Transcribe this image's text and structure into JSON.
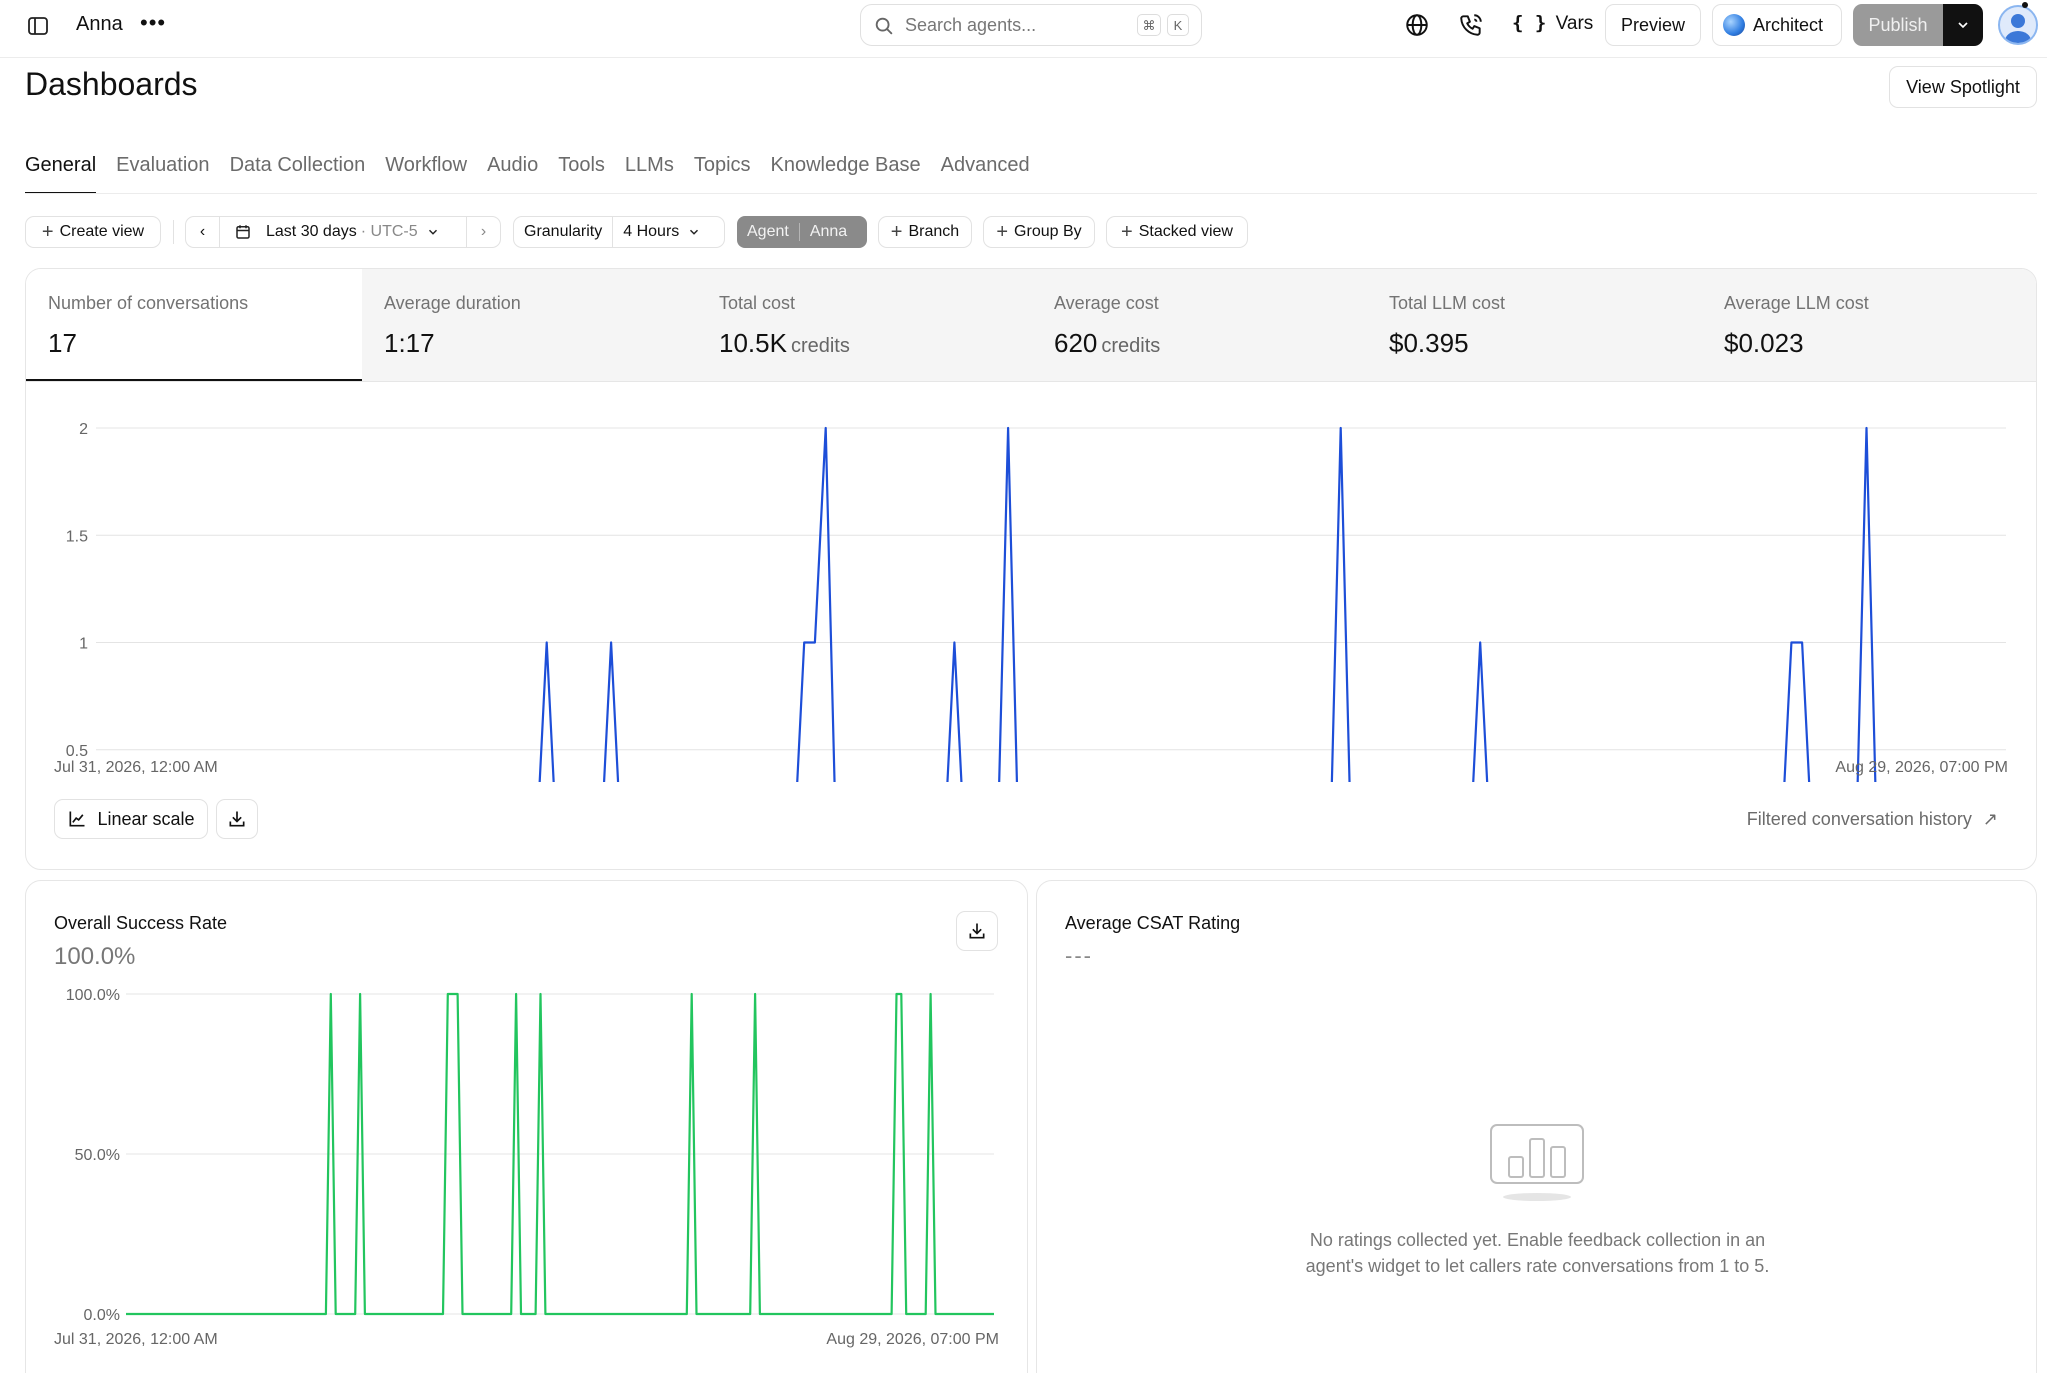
{
  "topbar": {
    "agent_name": "Anna",
    "search_placeholder": "Search agents...",
    "shortcut_mod": "⌘",
    "shortcut_key": "K",
    "vars_label": "Vars",
    "preview_label": "Preview",
    "architect_label": "Architect",
    "publish_label": "Publish"
  },
  "page": {
    "title": "Dashboards",
    "view_spotlight_label": "View Spotlight"
  },
  "tabs": [
    "General",
    "Evaluation",
    "Data Collection",
    "Workflow",
    "Audio",
    "Tools",
    "LLMs",
    "Topics",
    "Knowledge Base",
    "Advanced"
  ],
  "filters": {
    "create_view": "Create view",
    "date_range": "Last 30 days",
    "timezone": "· UTC-5",
    "granularity_label": "Granularity",
    "granularity_value": "4 Hours",
    "agent_label": "Agent",
    "agent_value": "Anna",
    "branch": "Branch",
    "group_by": "Group By",
    "stacked_view": "Stacked view"
  },
  "metrics": [
    {
      "label": "Number of conversations",
      "value": "17",
      "unit": ""
    },
    {
      "label": "Average duration",
      "value": "1:17",
      "unit": ""
    },
    {
      "label": "Total cost",
      "value": "10.5K",
      "unit": "credits"
    },
    {
      "label": "Average cost",
      "value": "620",
      "unit": "credits"
    },
    {
      "label": "Total LLM cost",
      "value": "$0.395",
      "unit": ""
    },
    {
      "label": "Average LLM cost",
      "value": "$0.023",
      "unit": ""
    }
  ],
  "main_chart": {
    "start_label": "Jul 31, 2026, 12:00 AM",
    "end_label": "Aug 29, 2026, 07:00 PM",
    "scale_button": "Linear scale",
    "history_link": "Filtered conversation history",
    "history_arrow": "↗"
  },
  "success_card": {
    "title": "Overall Success Rate",
    "value": "100.0%",
    "start_label": "Jul 31, 2026, 12:00 AM",
    "end_label": "Aug 29, 2026, 07:00 PM"
  },
  "csat_card": {
    "title": "Average CSAT Rating",
    "value": "---",
    "empty_line1": "No ratings collected yet. Enable feedback collection in an",
    "empty_line2": "agent's widget to let callers rate conversations from 1 to 5."
  },
  "colors": {
    "conversations_line": "#1d4ed8",
    "success_line": "#22c55e",
    "publish_bg": "#9a9a9a",
    "agent_chip_bg": "#8a8a8a"
  },
  "chart_data": [
    {
      "type": "line",
      "title": "",
      "series": [
        {
          "values": []
        }
      ],
      "x_start": "Jul 31, 2026, 12:00 AM",
      "x_end": "Aug 29, 2026, 07:00 PM",
      "x_step_hours": 4,
      "num_points": 179,
      "nonzero_points": [
        [
          42,
          1
        ],
        [
          48,
          1
        ],
        [
          66,
          1
        ],
        [
          67,
          1
        ],
        [
          68,
          2
        ],
        [
          80,
          1
        ],
        [
          85,
          2
        ],
        [
          116,
          2
        ],
        [
          129,
          1
        ],
        [
          158,
          1
        ],
        [
          159,
          1
        ],
        [
          165,
          2
        ]
      ],
      "ylim": [
        0,
        2
      ],
      "yticks": [
        "0",
        "0.5",
        "1",
        "1.5",
        "2"
      ],
      "grid": true,
      "scale": "linear"
    },
    {
      "type": "line",
      "title": "",
      "series": [
        {
          "values": []
        }
      ],
      "x_start": "Jul 31, 2026, 12:00 AM",
      "x_end": "Aug 29, 2026, 07:00 PM",
      "x_step_hours": 4,
      "num_points": 179,
      "nonzero_points": [
        [
          42,
          100
        ],
        [
          48,
          100
        ],
        [
          66,
          100
        ],
        [
          67,
          100
        ],
        [
          68,
          100
        ],
        [
          80,
          100
        ],
        [
          85,
          100
        ],
        [
          116,
          100
        ],
        [
          129,
          100
        ],
        [
          158,
          100
        ],
        [
          159,
          100
        ],
        [
          165,
          100
        ]
      ],
      "ylim": [
        0,
        100
      ],
      "yticks": [
        "0.0%",
        "50.0%",
        "100.0%"
      ],
      "grid": true
    }
  ]
}
